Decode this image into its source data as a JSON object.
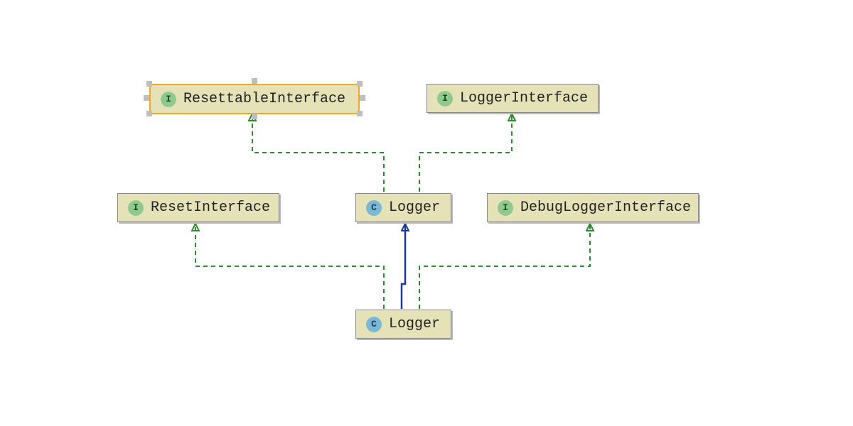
{
  "nodes": {
    "resettable_interface": {
      "label": "ResettableInterface",
      "type": "I"
    },
    "logger_interface": {
      "label": "LoggerInterface",
      "type": "I"
    },
    "reset_interface": {
      "label": "ResetInterface",
      "type": "I"
    },
    "logger_class": {
      "label": "Logger",
      "type": "C"
    },
    "debug_logger_interface": {
      "label": "DebugLoggerInterface",
      "type": "I"
    },
    "logger_class2": {
      "label": "Logger",
      "type": "C"
    }
  },
  "icon_letters": {
    "interface": "I",
    "class": "C"
  },
  "colors": {
    "node_bg": "#e6e2b8",
    "interface_icon": "#8fc98f",
    "class_icon": "#7ab8d4",
    "selection": "#f5a623",
    "dashed_line": "#2e8b2e",
    "solid_line": "#1a3a9a",
    "handle": "#bfbfbf"
  },
  "edges": [
    {
      "from": "logger_class",
      "to": "resettable_interface",
      "style": "dashed"
    },
    {
      "from": "logger_class",
      "to": "logger_interface",
      "style": "dashed"
    },
    {
      "from": "logger_class2",
      "to": "reset_interface",
      "style": "dashed"
    },
    {
      "from": "logger_class2",
      "to": "logger_class",
      "style": "solid"
    },
    {
      "from": "logger_class2",
      "to": "debug_logger_interface",
      "style": "dashed"
    }
  ]
}
